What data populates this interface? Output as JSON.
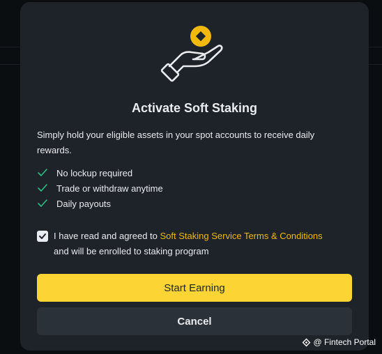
{
  "modal": {
    "title": "Activate Soft Staking",
    "description": "Simply hold your eligible assets in your spot accounts to receive daily rewards.",
    "features": [
      "No lockup required",
      "Trade or withdraw anytime",
      "Daily payouts"
    ],
    "agreement": {
      "checked": true,
      "prefix": "I have read and agreed to",
      "link_text": "Soft Staking Service Terms & Conditions",
      "suffix": "and will be enrolled to staking program"
    },
    "primary_button": "Start Earning",
    "secondary_button": "Cancel"
  },
  "watermark": {
    "text": "@ Fintech Portal"
  },
  "icons": {
    "illustration": "hand-holding-coin-icon",
    "feature_check": "check-icon",
    "agreement_checkbox": "checkbox-checked-icon",
    "watermark_logo": "diamond-logo-icon"
  },
  "colors": {
    "accent": "#fcd535",
    "link": "#f0b90b",
    "check": "#2ebd85",
    "modal_bg": "#1e2329"
  }
}
